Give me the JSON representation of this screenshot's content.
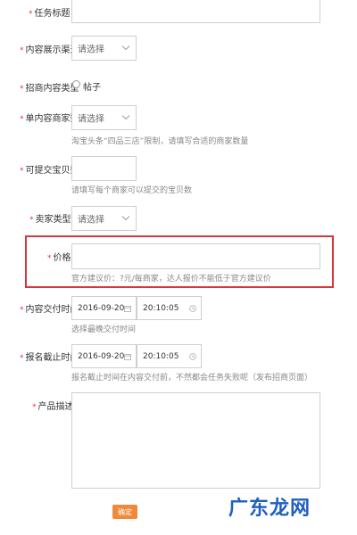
{
  "form": {
    "task_title": {
      "label": "任务标题",
      "value": ""
    },
    "display_channel": {
      "label": "内容展示渠道",
      "value": "请选择"
    },
    "content_type": {
      "label": "招商内容类型",
      "option": "帖子"
    },
    "merchants_per_content": {
      "label": "单内容商家数",
      "value": "请选择",
      "hint": "淘宝头条“四品三店”限制，请填写合适的商家数量"
    },
    "submit_items": {
      "label": "可提交宝贝数",
      "value": "",
      "hint": "请填写每个商家可以提交的宝贝数"
    },
    "seller_type": {
      "label": "卖家类型",
      "value": "请选择"
    },
    "price": {
      "label": "价格",
      "value": "",
      "hint": "官方建议价：?元/每商家，达人报价不能低于官方建议价"
    },
    "delivery_time": {
      "label": "内容交付时间",
      "date": "2016-09-20",
      "time": "20:10:05",
      "hint": "选择最晚交付时间"
    },
    "signup_deadline": {
      "label": "报名截止时间",
      "date": "2016-09-20",
      "time": "20:10:05",
      "hint": "报名截止时间在内容交付前，不然都会任务失败呢（发布招商页面）"
    },
    "description": {
      "label": "产品描述",
      "value": ""
    },
    "confirm_label": "确定"
  },
  "watermark": {
    "text": "广东龙网"
  },
  "colors": {
    "required_star": "#e4393c",
    "highlight_border": "#d9353c",
    "confirm_button": "#f08a3a",
    "watermark": "#1f5fbf"
  }
}
